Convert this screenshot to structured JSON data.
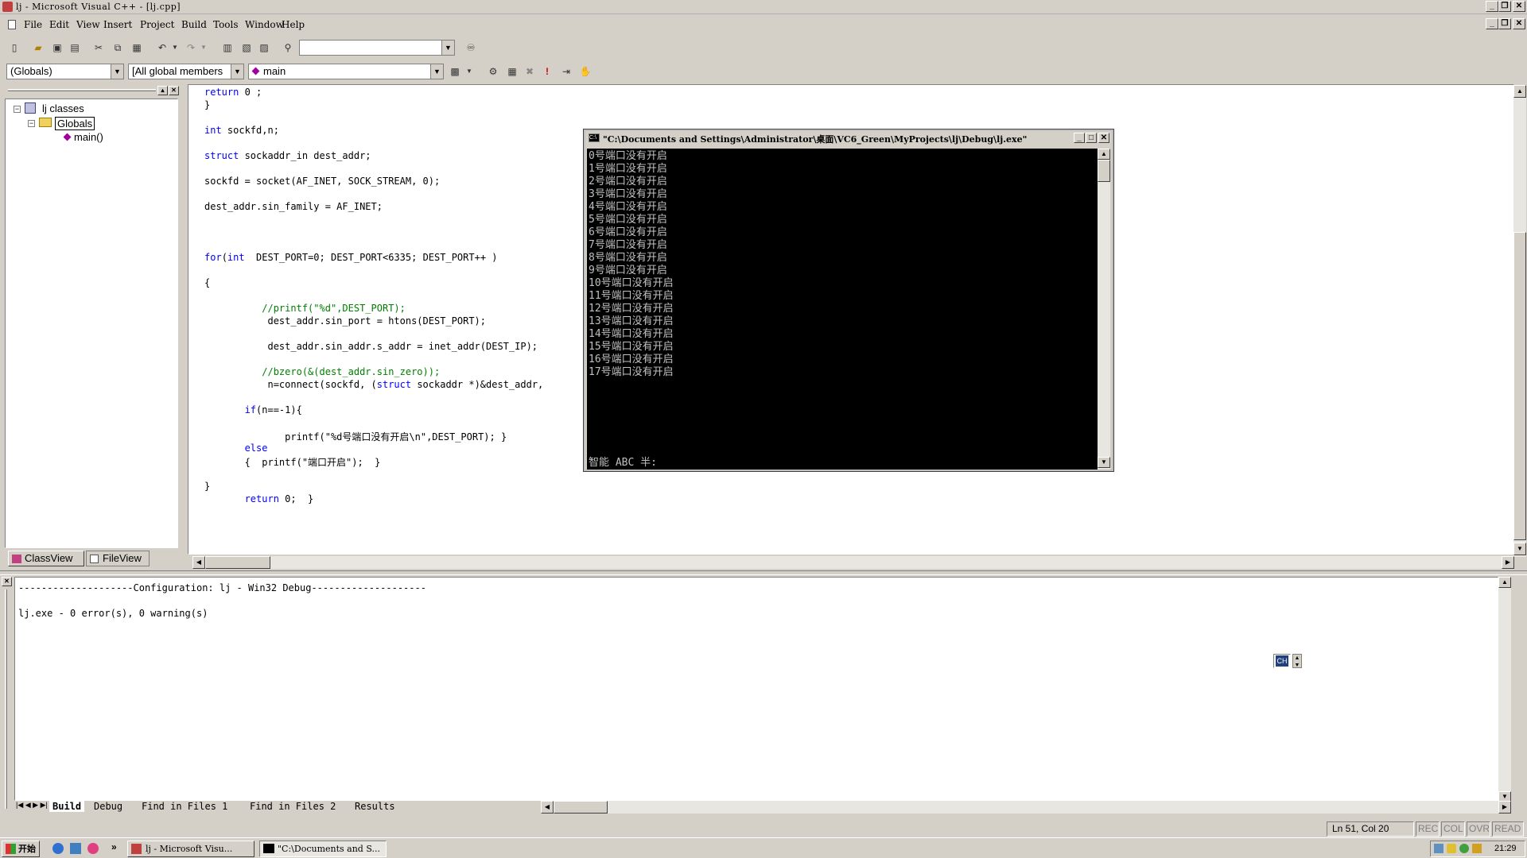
{
  "window": {
    "title": "lj - Microsoft Visual C++ - [lj.cpp]"
  },
  "menu": [
    "File",
    "Edit",
    "View",
    "Insert",
    "Project",
    "Build",
    "Tools",
    "Window",
    "Help"
  ],
  "toolbar": {
    "find_combo_value": "",
    "scope_combo": "(Globals)",
    "members_combo": "[All global members",
    "function_combo": "main"
  },
  "classview": {
    "root": "lj classes",
    "folder": "Globals",
    "item": "main()",
    "tabs": [
      "ClassView",
      "FileView"
    ]
  },
  "editor": {
    "lines": [
      {
        "t": "return 0 ;"
      },
      {
        "t": "}"
      },
      {
        "t": ""
      },
      {
        "t": "int sockfd,n;"
      },
      {
        "t": ""
      },
      {
        "t": "struct sockaddr_in dest_addr;"
      },
      {
        "t": ""
      },
      {
        "t": "sockfd = socket(AF_INET, SOCK_STREAM, 0);"
      },
      {
        "t": ""
      },
      {
        "t": "dest_addr.sin_family = AF_INET;"
      },
      {
        "t": ""
      },
      {
        "t": ""
      },
      {
        "t": ""
      },
      {
        "t": "for(int  DEST_PORT=0; DEST_PORT<6335; DEST_PORT++ )"
      },
      {
        "t": ""
      },
      {
        "t": "{"
      },
      {
        "t": ""
      },
      {
        "t": "          //printf(\"%d\",DEST_PORT);"
      },
      {
        "t": "           dest_addr.sin_port = htons(DEST_PORT);"
      },
      {
        "t": ""
      },
      {
        "t": "           dest_addr.sin_addr.s_addr = inet_addr(DEST_IP);"
      },
      {
        "t": ""
      },
      {
        "t": "          //bzero(&(dest_addr.sin_zero));"
      },
      {
        "t": "           n=connect(sockfd, (struct sockaddr *)&dest_addr,"
      },
      {
        "t": ""
      },
      {
        "t": "       if(n==-1){"
      },
      {
        "t": ""
      },
      {
        "t": "              printf(\"%d号端口没有开启\\n\",DEST_PORT); }"
      },
      {
        "t": "       else"
      },
      {
        "t": "       {  printf(\"端口开启\");  }"
      },
      {
        "t": ""
      },
      {
        "t": "}"
      },
      {
        "t": "       return 0;  }"
      }
    ]
  },
  "console": {
    "title": "\"C:\\Documents and Settings\\Administrator\\桌面\\VC6_Green\\MyProjects\\lj\\Debug\\lj.exe\"",
    "lines": [
      "0号端口没有开启",
      "1号端口没有开启",
      "2号端口没有开启",
      "3号端口没有开启",
      "4号端口没有开启",
      "5号端口没有开启",
      "6号端口没有开启",
      "7号端口没有开启",
      "8号端口没有开启",
      "9号端口没有开启",
      "10号端口没有开启",
      "11号端口没有开启",
      "12号端口没有开启",
      "13号端口没有开启",
      "14号端口没有开启",
      "15号端口没有开启",
      "16号端口没有开启",
      "17号端口没有开启"
    ],
    "ime_status": "智能 ABC 半:"
  },
  "output": {
    "lines": [
      "--------------------Configuration: lj - Win32 Debug--------------------",
      "",
      "lj.exe - 0 error(s), 0 warning(s)"
    ],
    "tabs": [
      "Build",
      "Debug",
      "Find in Files 1",
      "Find in Files 2",
      "Results"
    ],
    "ime_badge": "CH"
  },
  "status": {
    "position": "Ln 51, Col 20",
    "indicators": [
      "REC",
      "COL",
      "OVR",
      "READ"
    ]
  },
  "taskbar": {
    "start": "开始",
    "tasks": [
      "lj - Microsoft Visu...",
      "\"C:\\Documents and S..."
    ],
    "clock": "21:29"
  }
}
